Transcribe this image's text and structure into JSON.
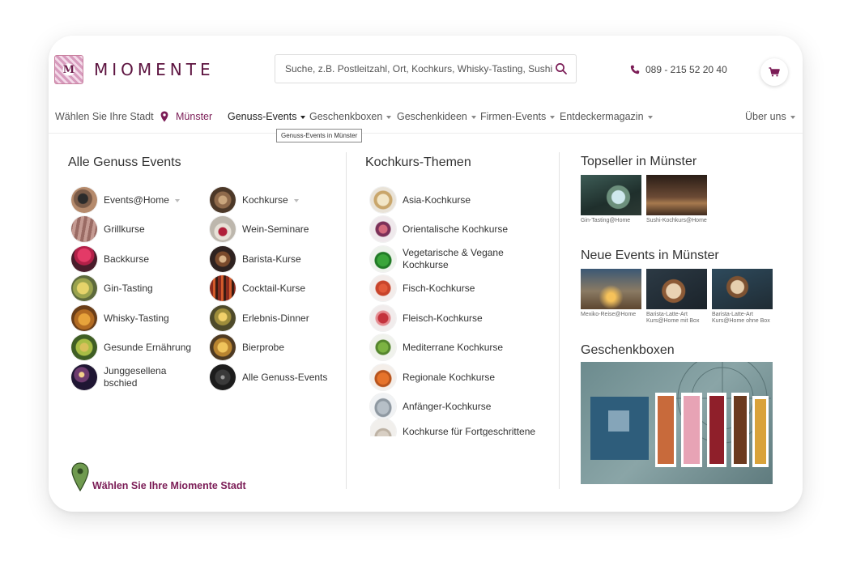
{
  "header": {
    "logo_text": "MIOMENTE",
    "logo_letter": "M",
    "search_placeholder": "Suche, z.B. Postleitzahl, Ort, Kochkurs, Whisky-Tasting, Sushi...",
    "phone": "089 - 215 52 20 40",
    "brand_color": "#7b1c56"
  },
  "nav": {
    "choose_city": "Wählen Sie Ihre Stadt",
    "city": "Münster",
    "items": [
      "Genuss-Events",
      "Geschenkboxen",
      "Geschenkideen",
      "Firmen-Events",
      "Entdeckermagazin"
    ],
    "about": "Über uns",
    "tooltip": "Genuss-Events in Münster"
  },
  "menu": {
    "genuss_title": "Alle Genuss Events",
    "genuss_left": [
      {
        "label": "Events@Home",
        "caret": true,
        "icon": "phone-home-icon"
      },
      {
        "label": "Grillkurse",
        "icon": "grill-icon"
      },
      {
        "label": "Backkurse",
        "icon": "cupcake-icon"
      },
      {
        "label": "Gin-Tasting",
        "icon": "gin-icon"
      },
      {
        "label": "Whisky-Tasting",
        "icon": "whisky-icon"
      },
      {
        "label": "Gesunde Ernährung",
        "icon": "avocado-icon"
      },
      {
        "label": "Junggesellena bschied",
        "icon": "party-icon"
      }
    ],
    "genuss_right": [
      {
        "label": "Kochkurse",
        "caret": true,
        "icon": "cooking-icon"
      },
      {
        "label": "Wein-Seminare",
        "icon": "wine-icon"
      },
      {
        "label": "Barista-Kurse",
        "icon": "coffee-icon"
      },
      {
        "label": "Cocktail-Kurse",
        "icon": "cocktail-icon"
      },
      {
        "label": "Erlebnis-Dinner",
        "icon": "dinner-icon"
      },
      {
        "label": "Bierprobe",
        "icon": "beer-icon"
      },
      {
        "label": "Alle Genuss-Events",
        "icon": "cutlery-icon"
      }
    ],
    "koch_title": "Kochkurs-Themen",
    "koch": [
      {
        "label": "Asia-Kochkurse",
        "icon": "dumpling-icon"
      },
      {
        "label": "Orientalische Kochkurse",
        "icon": "fig-icon"
      },
      {
        "label": "Vegetarische & Vegane Kochkurse",
        "icon": "pepper-icon"
      },
      {
        "label": "Fisch-Kochkurse",
        "icon": "crab-icon"
      },
      {
        "label": "Fleisch-Kochkurse",
        "icon": "meat-icon"
      },
      {
        "label": "Mediterrane Kochkurse",
        "icon": "salad-icon"
      },
      {
        "label": "Regionale Kochkurse",
        "icon": "pumpkin-icon"
      },
      {
        "label": "Anfänger-Kochkurse",
        "icon": "pot-icon"
      },
      {
        "label": "Kochkurse für Fortgeschrittene",
        "icon": "pasta-icon"
      }
    ],
    "topseller_title": "Topseller in Münster",
    "topseller": [
      {
        "caption": "Gin-Tasting@Home"
      },
      {
        "caption": "Sushi-Kochkurs@Home"
      }
    ],
    "neue_title": "Neue Events in Münster",
    "neue": [
      {
        "caption": "Mexiko-Reise@Home"
      },
      {
        "caption": "Barista-Latte-Art Kurs@Home mit Box"
      },
      {
        "caption": "Barista-Latte-Art Kurs@Home ohne Box"
      }
    ],
    "geschenk_title": "Geschenkboxen",
    "choose_city_link": "Wählen Sie Ihre Miomente Stadt"
  }
}
